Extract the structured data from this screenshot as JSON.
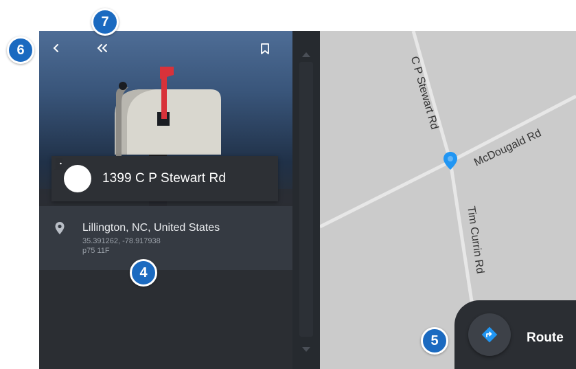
{
  "header": {
    "back_icon": "chevron-left-icon",
    "collapse_icon": "double-chevron-left-icon",
    "bookmark_icon": "bookmark-icon"
  },
  "poi": {
    "icon": "door-icon",
    "title": "1399 C P Stewart Rd",
    "address": "Lillington, NC, United States",
    "coordinates": "35.391262, -78.917938",
    "plus_code": "p75 11F"
  },
  "map": {
    "roads": [
      {
        "label": "C P Stewart Rd"
      },
      {
        "label": "McDougald Rd"
      },
      {
        "label": "Tim Currin Rd"
      }
    ],
    "marker_color": "#2196f3"
  },
  "route": {
    "label": "Route",
    "icon": "route-diamond-icon",
    "icon_color": "#2196f3"
  },
  "callouts": {
    "c4": "4",
    "c5": "5",
    "c6": "6",
    "c7": "7"
  },
  "colors": {
    "panel": "#2b2e33",
    "callout": "#1b6ac0",
    "map": "#cbcbcb"
  }
}
